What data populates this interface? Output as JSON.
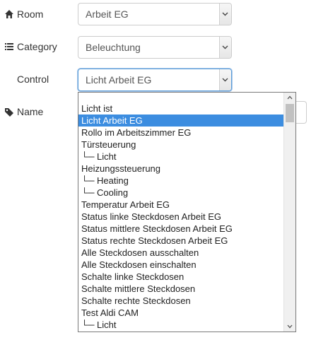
{
  "room": {
    "label": "Room",
    "icon": "home-icon",
    "value": "Arbeit EG"
  },
  "category": {
    "label": "Category",
    "icon": "list-icon",
    "value": "Beleuchtung"
  },
  "control": {
    "label": "Control",
    "value": "Licht Arbeit EG"
  },
  "name": {
    "label": "Name",
    "icon": "tag-icon"
  },
  "dropdown": {
    "options": [
      "Licht ist",
      "Licht Arbeit EG",
      "Rollo im Arbeitszimmer EG",
      "Türsteuerung",
      "└─ Licht",
      "Heizungssteuerung",
      "└─ Heating",
      "└─ Cooling",
      "Temperatur Arbeit EG",
      "Status linke Steckdosen Arbeit EG",
      "Status mittlere Steckdosen Arbeit EG",
      "Status rechte Steckdosen Arbeit EG",
      "Alle Steckdosen ausschalten",
      "Alle Steckdosen einschalten",
      "Schalte linke Steckdosen",
      "Schalte mittlere Steckdosen",
      "Schalte rechte Steckdosen",
      "Test Aldi CAM",
      "└─ Licht"
    ],
    "selected_index": 1
  },
  "colors": {
    "selected_bg": "#3c8de0",
    "focus_border": "#5b9dd9"
  }
}
